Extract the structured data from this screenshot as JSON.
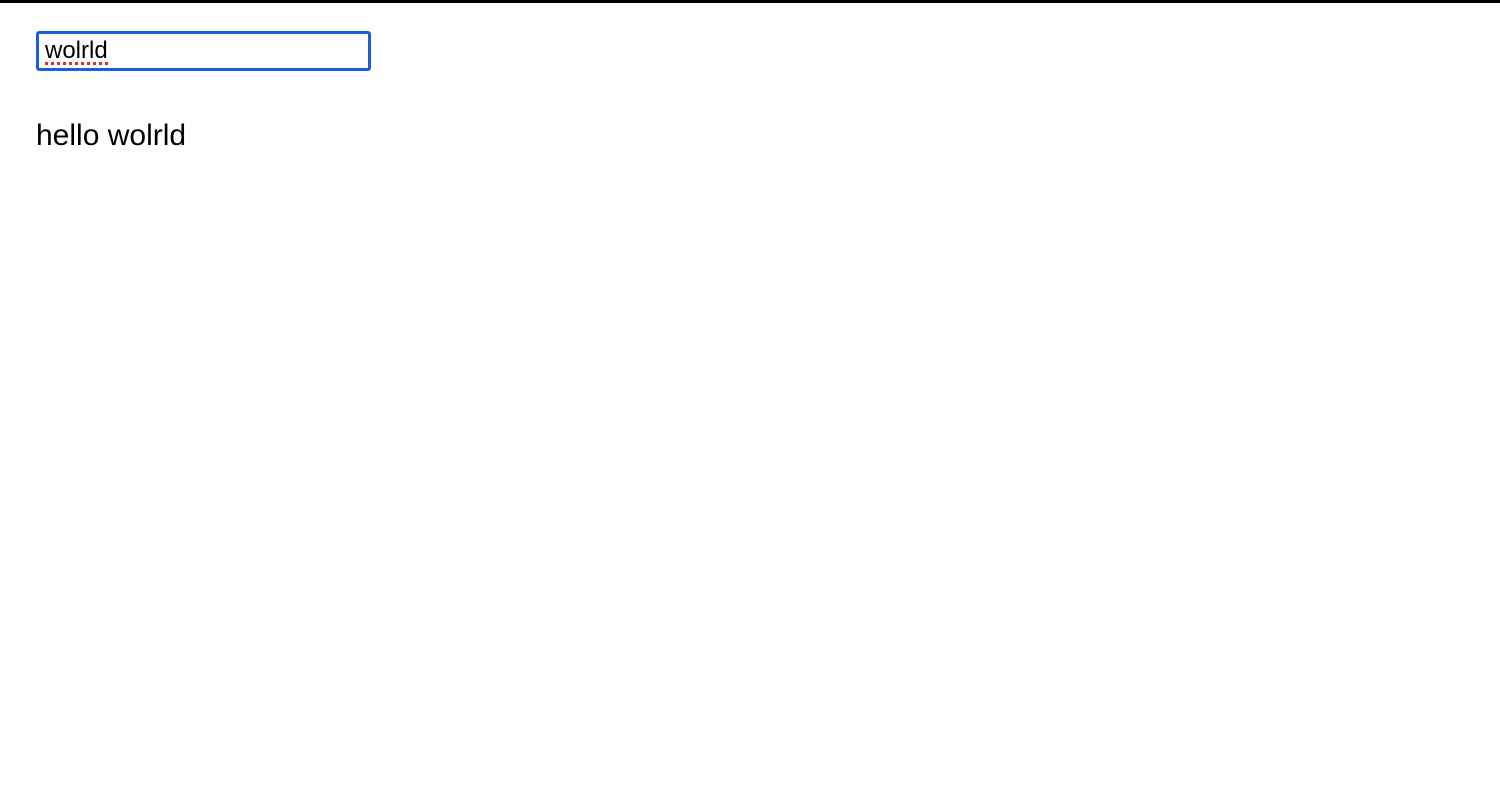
{
  "input": {
    "value": "wolrld"
  },
  "output": {
    "text": "hello wolrld"
  },
  "colors": {
    "focus_border": "#1a5fd8",
    "spellcheck": "#d93025"
  }
}
